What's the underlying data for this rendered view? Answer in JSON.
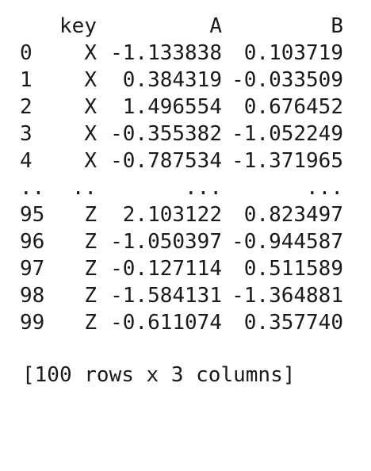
{
  "table": {
    "header": {
      "index": "",
      "key": "key",
      "a": "A",
      "b": "B"
    },
    "rows": [
      {
        "index": "0",
        "key": "X",
        "a": "-1.133838",
        "b": "0.103719"
      },
      {
        "index": "1",
        "key": "X",
        "a": "0.384319",
        "b": "-0.033509"
      },
      {
        "index": "2",
        "key": "X",
        "a": "1.496554",
        "b": "0.676452"
      },
      {
        "index": "3",
        "key": "X",
        "a": "-0.355382",
        "b": "-1.052249"
      },
      {
        "index": "4",
        "key": "X",
        "a": "-0.787534",
        "b": "-1.371965"
      },
      {
        "index": "..",
        "key": "..",
        "a": "...",
        "b": "..."
      },
      {
        "index": "95",
        "key": "Z",
        "a": "2.103122",
        "b": "0.823497"
      },
      {
        "index": "96",
        "key": "Z",
        "a": "-1.050397",
        "b": "-0.944587"
      },
      {
        "index": "97",
        "key": "Z",
        "a": "-0.127114",
        "b": "0.511589"
      },
      {
        "index": "98",
        "key": "Z",
        "a": "-1.584131",
        "b": "-1.364881"
      },
      {
        "index": "99",
        "key": "Z",
        "a": "-0.611074",
        "b": "0.357740"
      }
    ],
    "footer": "[100 rows x 3 columns]"
  }
}
